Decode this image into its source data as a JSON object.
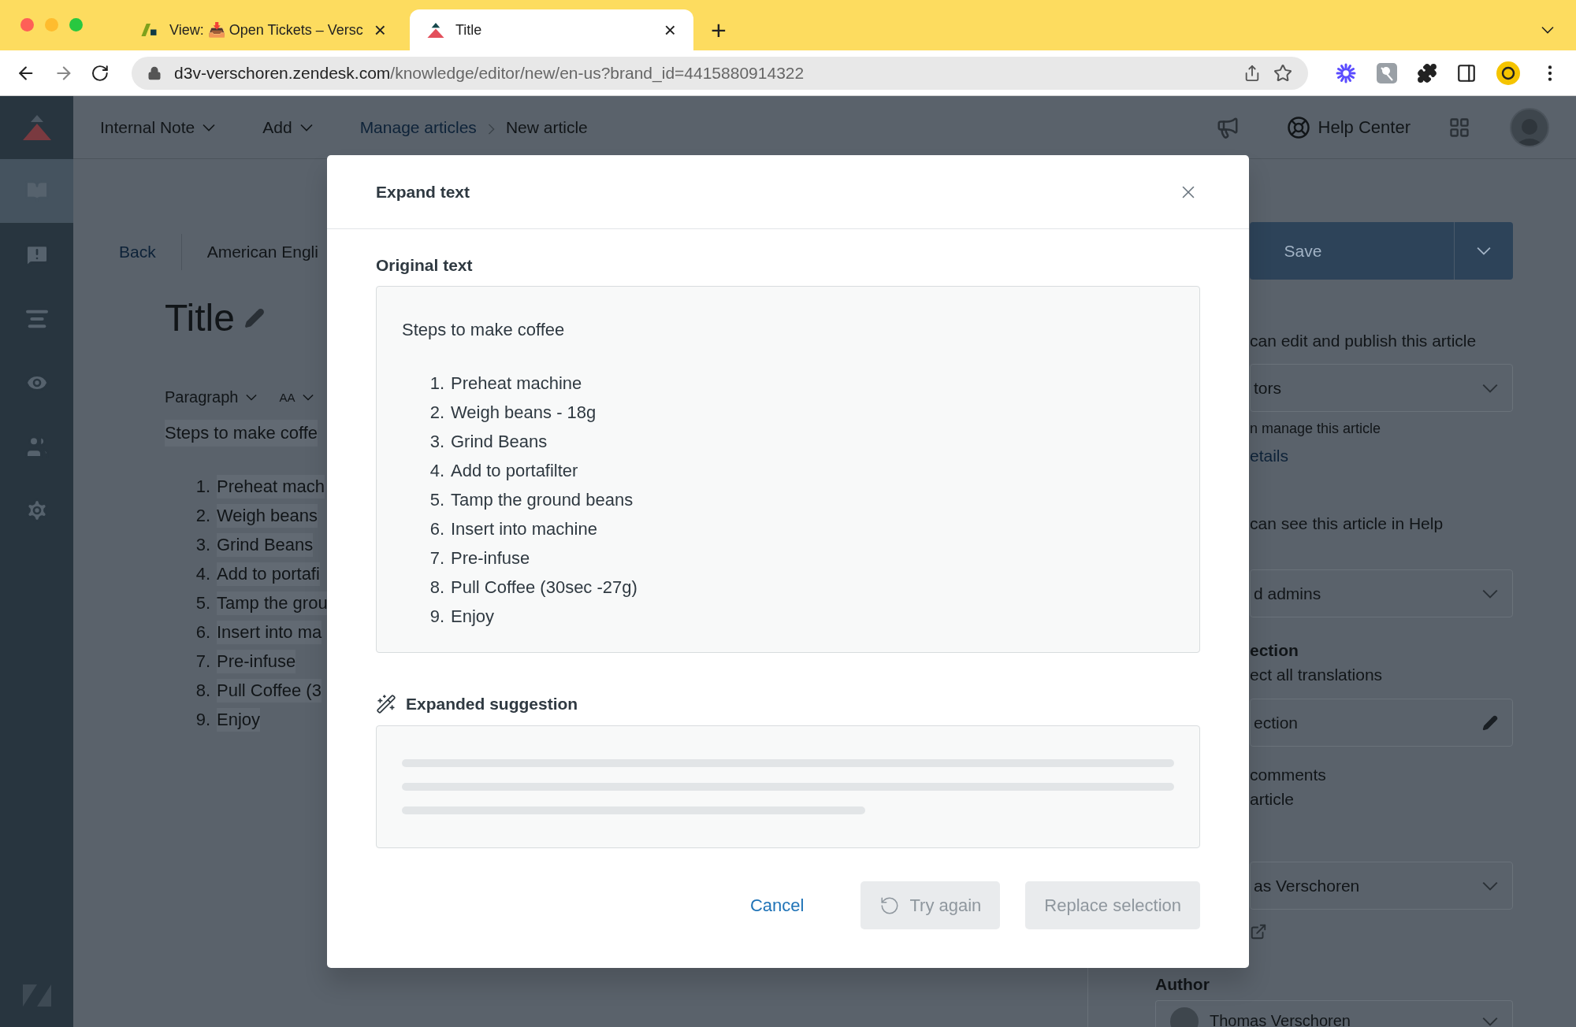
{
  "browser": {
    "tabs": [
      {
        "title": "View: 📥 Open Tickets – Versc",
        "close": "×",
        "selected": false
      },
      {
        "title": "Title",
        "close": "×",
        "selected": true
      }
    ],
    "new_tab": "+",
    "url_host": "d3v-verschoren.zendesk.com",
    "url_path": "/knowledge/editor/new/en-us?brand_id=4415880914322"
  },
  "nav": {
    "items": [
      {
        "selected": true
      },
      {
        "selected": false
      },
      {
        "selected": false
      },
      {
        "selected": false
      },
      {
        "selected": false
      },
      {
        "selected": false
      }
    ]
  },
  "header": {
    "menus": [
      "Internal Note",
      "Add"
    ],
    "breadcrumb": [
      "Manage articles",
      "New article"
    ],
    "help_center": "Help Center"
  },
  "editor": {
    "back": "Back",
    "language": "American Engli",
    "title": "Title",
    "toolbar": [
      "Paragraph",
      "AA"
    ],
    "intro": "Steps to make coffe",
    "steps": [
      {
        "number": "1.",
        "text": "Preheat mach"
      },
      {
        "number": "2.",
        "text": "Weigh beans"
      },
      {
        "number": "3.",
        "text": "Grind Beans"
      },
      {
        "number": "4.",
        "text": "Add to portafi"
      },
      {
        "number": "5.",
        "text": "Tamp the grou"
      },
      {
        "number": "6.",
        "text": "Insert into ma"
      },
      {
        "number": "7.",
        "text": "Pre-infuse"
      },
      {
        "number": "8.",
        "text": "Pull Coffee (3"
      },
      {
        "number": "9.",
        "text": "Enjoy"
      }
    ]
  },
  "sidebar": {
    "save": "Save",
    "items": [
      {
        "kind": "text",
        "text": "can edit and publish this article"
      },
      {
        "kind": "select",
        "value": "tors"
      },
      {
        "kind": "small",
        "text": "n manage this article"
      },
      {
        "kind": "link",
        "text": "etails"
      },
      {
        "kind": "text",
        "text": "can see this article in Help"
      },
      {
        "kind": "select",
        "value": "d admins"
      },
      {
        "kind": "heading",
        "text": "ection"
      },
      {
        "kind": "text",
        "text": "ect all translations"
      },
      {
        "kind": "field",
        "value": "ection"
      },
      {
        "kind": "text",
        "text": "comments"
      },
      {
        "kind": "text",
        "text": "article"
      },
      {
        "kind": "select",
        "value": "as Verschoren"
      },
      {
        "kind": "external"
      }
    ],
    "author_label": "Author",
    "author": "Thomas Verschoren"
  },
  "modal": {
    "title": "Expand text",
    "original_label": "Original text",
    "original_intro": "Steps to make coffee",
    "original_steps": [
      {
        "number": "1.",
        "text": "Preheat machine"
      },
      {
        "number": "2.",
        "text": "Weigh beans - 18g"
      },
      {
        "number": "3.",
        "text": "Grind Beans"
      },
      {
        "number": "4.",
        "text": "Add to portafilter"
      },
      {
        "number": "5.",
        "text": "Tamp the ground beans"
      },
      {
        "number": "6.",
        "text": "Insert into machine"
      },
      {
        "number": "7.",
        "text": "Pre-infuse"
      },
      {
        "number": "8.",
        "text": "Pull Coffee (30sec -27g)"
      },
      {
        "number": "9.",
        "text": "Enjoy"
      }
    ],
    "suggestion_label": "Expanded suggestion",
    "suggestion_loading": true,
    "cancel": "Cancel",
    "try_again": {
      "label": "Try again",
      "disabled": true
    },
    "replace": {
      "label": "Replace selection",
      "disabled": true
    }
  }
}
